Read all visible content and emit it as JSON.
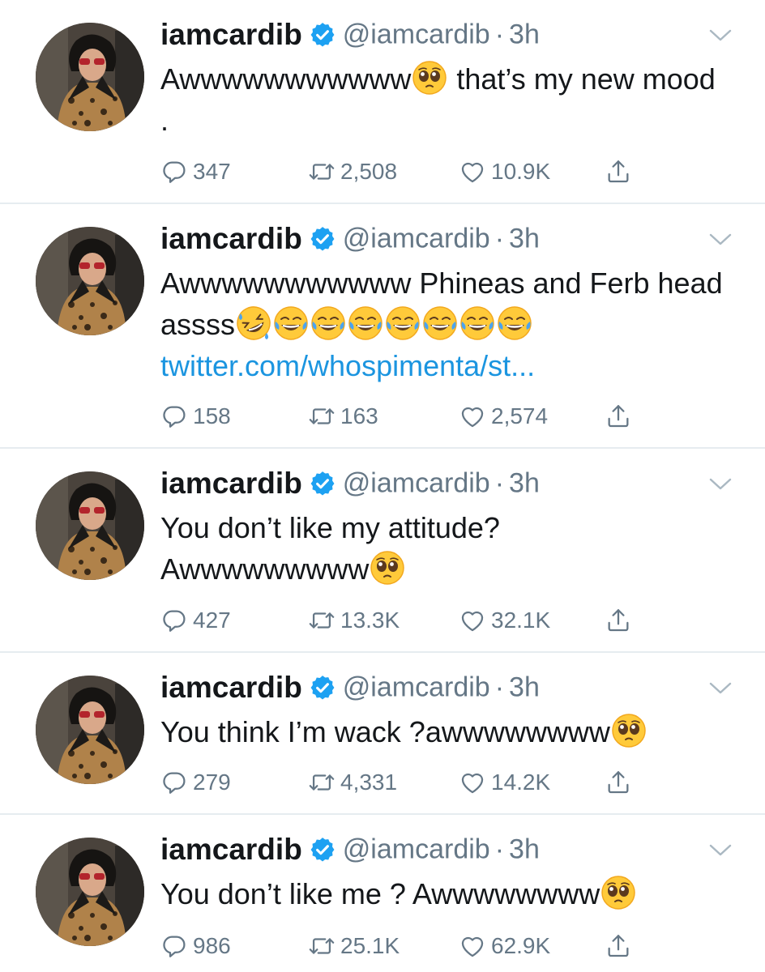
{
  "colors": {
    "accent": "#1da1f2",
    "link": "#1b95e0",
    "muted": "#657786",
    "text": "#14171a",
    "divider": "#e6ecf0"
  },
  "icons": {
    "reply": "reply-icon",
    "retweet": "retweet-icon",
    "like": "heart-icon",
    "share": "share-icon",
    "verified": "verified-badge-icon",
    "menu": "chevron-down-icon"
  },
  "tweets": [
    {
      "name": "iamcardib",
      "handle": "@iamcardib",
      "dot": "·",
      "time": "3h",
      "text_before": "Awwwwwwwwwww",
      "emojis": [
        "pleading"
      ],
      "text_after": " that’s my new mood .",
      "link": "",
      "replies": "347",
      "retweets": "2,508",
      "likes": "10.9K"
    },
    {
      "name": "iamcardib",
      "handle": "@iamcardib",
      "dot": "·",
      "time": "3h",
      "text_before": "Awwwwwwwwwww Phineas and Ferb head assss",
      "emojis": [
        "rofl",
        "joy",
        "joy",
        "joy",
        "joy",
        "joy",
        "joy",
        "joy"
      ],
      "text_after": "",
      "link": "twitter.com/whospimenta/st...",
      "replies": "158",
      "retweets": "163",
      "likes": "2,574"
    },
    {
      "name": "iamcardib",
      "handle": "@iamcardib",
      "dot": "·",
      "time": "3h",
      "text_before": "You don’t like my attitude? Awwwwwwwww",
      "emojis": [
        "pleading"
      ],
      "text_after": "",
      "link": "",
      "replies": "427",
      "retweets": "13.3K",
      "likes": "32.1K"
    },
    {
      "name": "iamcardib",
      "handle": "@iamcardib",
      "dot": "·",
      "time": "3h",
      "text_before": "You think I’m wack ?awwwwwwww",
      "emojis": [
        "pleading"
      ],
      "text_after": "",
      "link": "",
      "replies": "279",
      "retweets": "4,331",
      "likes": "14.2K"
    },
    {
      "name": "iamcardib",
      "handle": "@iamcardib",
      "dot": "·",
      "time": "3h",
      "text_before": "You don’t like me ? Awwwwwwww",
      "emojis": [
        "pleading"
      ],
      "text_after": "",
      "link": "",
      "replies": "986",
      "retweets": "25.1K",
      "likes": "62.9K"
    }
  ]
}
